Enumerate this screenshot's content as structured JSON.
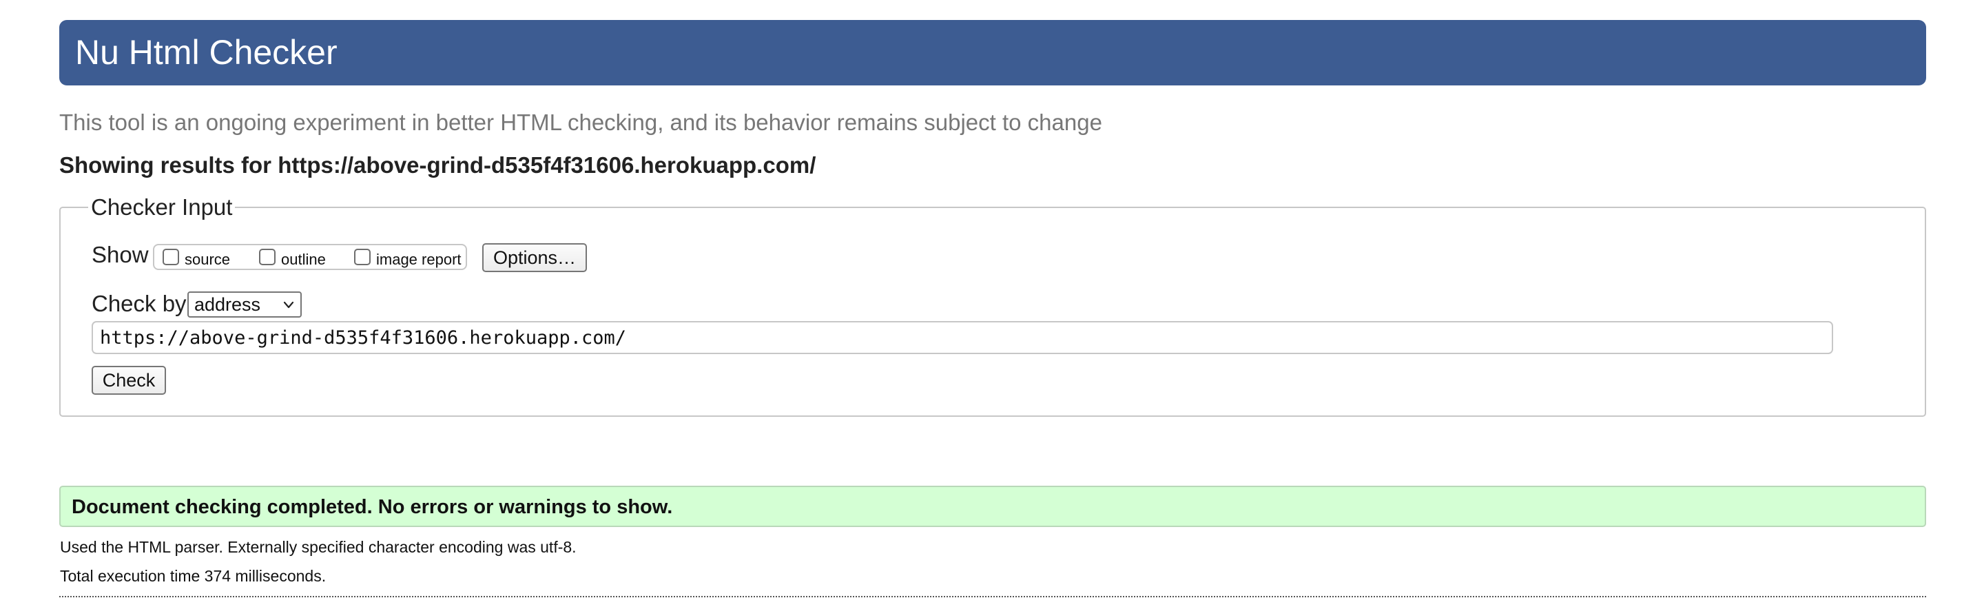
{
  "header": {
    "title": "Nu Html Checker"
  },
  "tagline": "This tool is an ongoing experiment in better HTML checking, and its behavior remains subject to change",
  "showing_results": "Showing results for https://above-grind-d535f4f31606.herokuapp.com/",
  "checker_input": {
    "legend": "Checker Input",
    "show_label": "Show",
    "show_options": [
      {
        "label": "source",
        "checked": false
      },
      {
        "label": "outline",
        "checked": false
      },
      {
        "label": "image report",
        "checked": false
      }
    ],
    "options_button": "Options…",
    "check_by_label": "Check by",
    "check_by_selected": "address",
    "url_value": "https://above-grind-d535f4f31606.herokuapp.com/",
    "check_button": "Check"
  },
  "result": {
    "message": "Document checking completed. No errors or warnings to show.",
    "parser_note": "Used the HTML parser. Externally specified character encoding was utf-8.",
    "execution_time": "Total execution time 374 milliseconds."
  },
  "colors": {
    "header_bg": "#3d5c92",
    "success_bg": "#d4ffd4",
    "tagline": "#777777"
  },
  "icons": {
    "select_chevron": "chevron-down-icon"
  }
}
